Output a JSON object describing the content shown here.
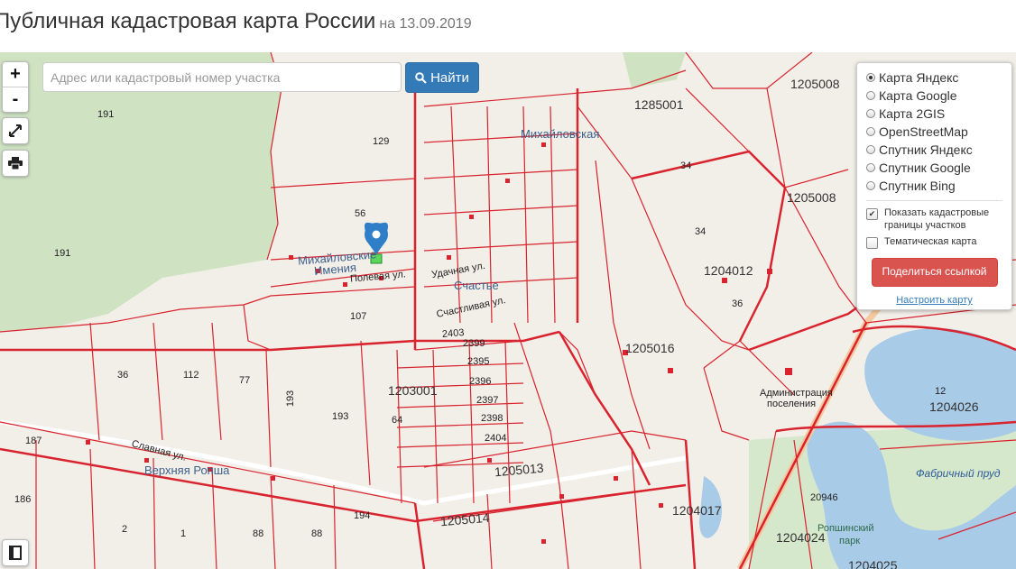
{
  "header": {
    "title": "Публичная кадастровая карта России",
    "date": "на 13.09.2019"
  },
  "toolbar": {
    "zoom_in": "+",
    "zoom_out": "-"
  },
  "search": {
    "placeholder": "Адрес или кадастровый номер участка",
    "value": "",
    "button_label": "Найти"
  },
  "layers": {
    "basemaps": [
      {
        "label": "Карта Яндекс",
        "selected": true
      },
      {
        "label": "Карта Google",
        "selected": false
      },
      {
        "label": "Карта 2GIS",
        "selected": false
      },
      {
        "label": "OpenStreetMap",
        "selected": false
      },
      {
        "label": "Спутник Яндекс",
        "selected": false
      },
      {
        "label": "Спутник Google",
        "selected": false
      },
      {
        "label": "Спутник Bing",
        "selected": false
      }
    ],
    "show_boundaries": {
      "label": "Показать кадастровые границы участков",
      "checked": true
    },
    "thematic": {
      "label": "Тематическая карта",
      "checked": false
    },
    "share_label": "Поделиться ссылкой",
    "configure_label": "Настроить карту"
  },
  "map": {
    "colors": {
      "boundary": "#d9232e",
      "forest": "#cfe3c3",
      "water": "#a8cbe8",
      "land": "#f2efe9"
    },
    "labels": [
      {
        "t": "191",
        "c": "lbl"
      },
      {
        "t": "129",
        "c": "lbl"
      },
      {
        "t": "56",
        "c": "lbl"
      },
      {
        "t": "191",
        "c": "lbl"
      },
      {
        "t": "107",
        "c": "lbl"
      },
      {
        "t": "36",
        "c": "lbl"
      },
      {
        "t": "112",
        "c": "lbl"
      },
      {
        "t": "77",
        "c": "lbl"
      },
      {
        "t": "193",
        "c": "lbl"
      },
      {
        "t": "193",
        "c": "lbl"
      },
      {
        "t": "187",
        "c": "lbl"
      },
      {
        "t": "186",
        "c": "lbl"
      },
      {
        "t": "2",
        "c": "lbl"
      },
      {
        "t": "1",
        "c": "lbl"
      },
      {
        "t": "88",
        "c": "lbl"
      },
      {
        "t": "88",
        "c": "lbl"
      },
      {
        "t": "194",
        "c": "lbl"
      },
      {
        "t": "64",
        "c": "lbl"
      },
      {
        "t": "34",
        "c": "lbl"
      },
      {
        "t": "34",
        "c": "lbl"
      },
      {
        "t": "36",
        "c": "lbl"
      },
      {
        "t": "12",
        "c": "lbl"
      },
      {
        "t": "20946",
        "c": "lbl"
      },
      {
        "t": "2399",
        "c": "lbl"
      },
      {
        "t": "2395",
        "c": "lbl"
      },
      {
        "t": "2396",
        "c": "lbl"
      },
      {
        "t": "2397",
        "c": "lbl"
      },
      {
        "t": "2398",
        "c": "lbl"
      },
      {
        "t": "2404",
        "c": "lbl"
      },
      {
        "t": "2403",
        "c": "lbl"
      },
      {
        "t": "1203001",
        "c": "lbl big"
      },
      {
        "t": "1205013",
        "c": "lbl big"
      },
      {
        "t": "1205014",
        "c": "lbl big"
      },
      {
        "t": "1205016",
        "c": "lbl big"
      },
      {
        "t": "1204012",
        "c": "lbl big"
      },
      {
        "t": "1285001",
        "c": "lbl big"
      },
      {
        "t": "1205008",
        "c": "lbl big"
      },
      {
        "t": "1205008",
        "c": "lbl big"
      },
      {
        "t": "1204026",
        "c": "lbl big"
      },
      {
        "t": "1204017",
        "c": "lbl big"
      },
      {
        "t": "1204024",
        "c": "lbl big"
      },
      {
        "t": "1204025",
        "c": "lbl big"
      },
      {
        "t": "Михайловские",
        "c": "lbl place"
      },
      {
        "t": "Имения",
        "c": "lbl place"
      },
      {
        "t": "Счастье",
        "c": "lbl place"
      },
      {
        "t": "Михайловская",
        "c": "lbl place"
      },
      {
        "t": "Верхняя Ропша",
        "c": "lbl place"
      },
      {
        "t": "Полевая ул.",
        "c": "lbl"
      },
      {
        "t": "Удачная ул.",
        "c": "lbl"
      },
      {
        "t": "Счастливая ул.",
        "c": "lbl"
      },
      {
        "t": "Славная ул.",
        "c": "lbl"
      },
      {
        "t": "Фабричный пруд",
        "c": "lbl water"
      },
      {
        "t": "Ропшинский",
        "c": "lbl park"
      },
      {
        "t": "парк",
        "c": "lbl park"
      },
      {
        "t": "Администрация",
        "c": "lbl"
      },
      {
        "t": "поселения",
        "c": "lbl"
      }
    ]
  }
}
